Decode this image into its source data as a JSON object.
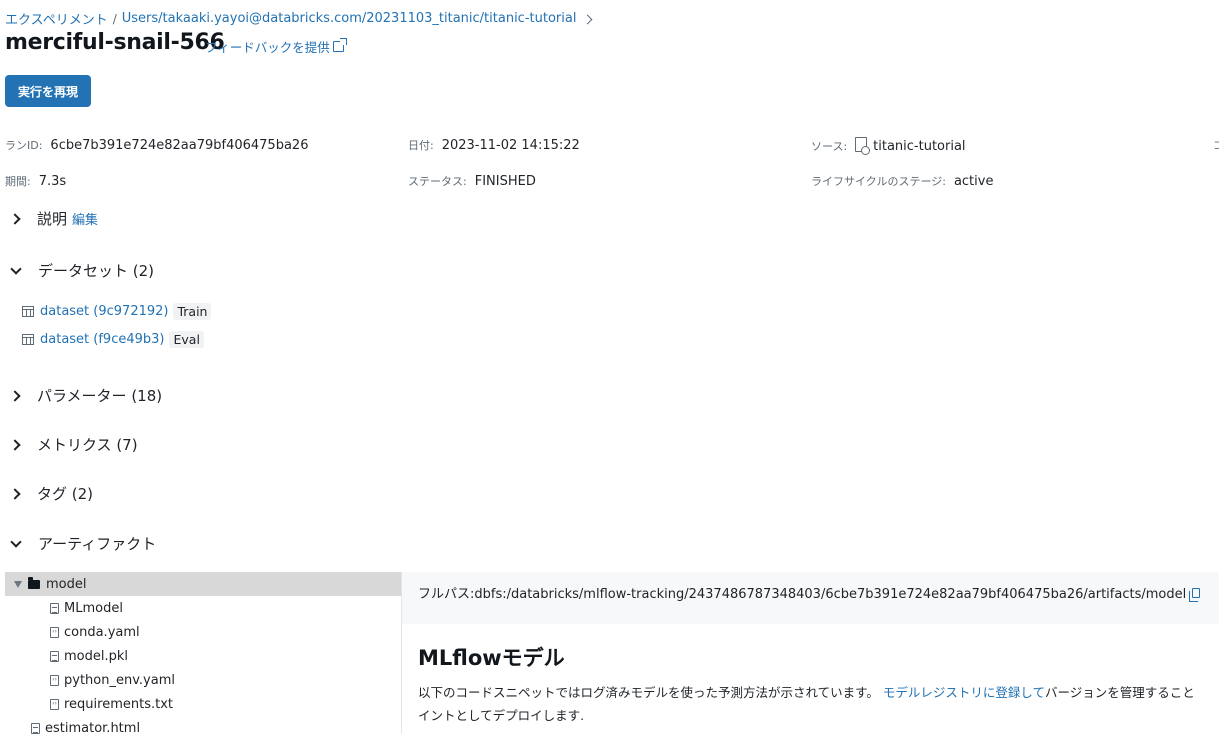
{
  "breadcrumb": {
    "experiments": "エクスペリメント",
    "separator": "/",
    "path": "Users/takaaki.yayoi@databricks.com/20231103_titanic/titanic-tutorial"
  },
  "run": {
    "name": "merciful-snail-566",
    "feedback": "フィードバックを提供",
    "reproduce_button": "実行を再現"
  },
  "meta": {
    "run_id_label": "ランID:",
    "run_id": "6cbe7b391e724e82aa79bf406475ba26",
    "date_label": "日付:",
    "date": "2023-11-02 14:15:22",
    "source_label": "ソース:",
    "source": "titanic-tutorial",
    "extra": "コ",
    "duration_label": "期間:",
    "duration": "7.3s",
    "status_label": "ステータス:",
    "status": "FINISHED",
    "lifecycle_label": "ライフサイクルのステージ:",
    "lifecycle": "active"
  },
  "sections": {
    "description": "説明",
    "edit": "編集",
    "datasets": "データセット (2)",
    "parameters": "パラメーター (18)",
    "metrics": "メトリクス (7)",
    "tags": "タグ (2)",
    "artifacts": "アーティファクト"
  },
  "datasets": [
    {
      "name": "dataset (9c972192)",
      "tag": "Train"
    },
    {
      "name": "dataset (f9ce49b3)",
      "tag": "Eval"
    }
  ],
  "tree": {
    "folder": "model",
    "children": [
      "MLmodel",
      "conda.yaml",
      "model.pkl",
      "python_env.yaml",
      "requirements.txt"
    ],
    "after": "estimator.html"
  },
  "artifact_panel": {
    "full_path": "フルパス:dbfs:/databricks/mlflow-tracking/2437486787348403/6cbe7b391e724e82aa79bf406475ba26/artifacts/model",
    "title": "MLflowモデル",
    "desc_prefix": "以下のコードスニペットではログ済みモデルを使った予測方法が示されています。",
    "desc_link": "モデルレジストリに登録して",
    "desc_suffix": "バージョンを管理すること",
    "desc_line2": "イントとしてデプロイします."
  }
}
